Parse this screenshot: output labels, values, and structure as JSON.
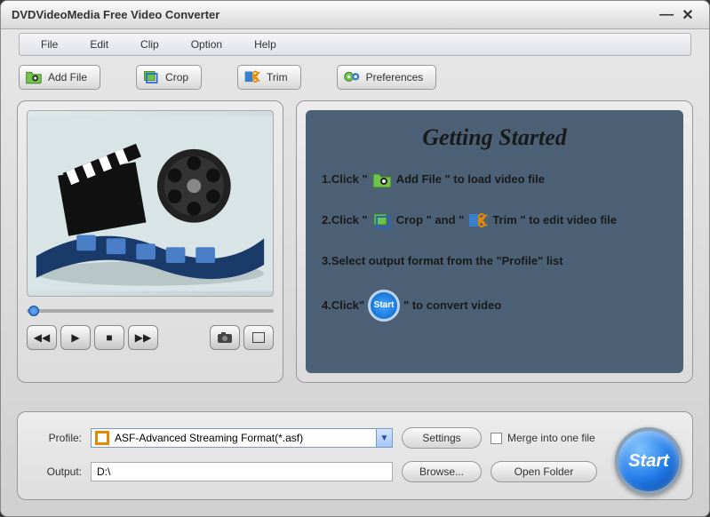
{
  "window": {
    "title": "DVDVideoMedia Free Video Converter"
  },
  "menu": {
    "file": "File",
    "edit": "Edit",
    "clip": "Clip",
    "option": "Option",
    "help": "Help"
  },
  "toolbar": {
    "add_file": "Add File",
    "crop": "Crop",
    "trim": "Trim",
    "preferences": "Preferences"
  },
  "guide": {
    "title": "Getting Started",
    "step1a": "1.Click \"",
    "step1b": "Add File \" to load video file",
    "step2a": "2.Click \"",
    "step2b": " Crop \" and \"",
    "step2c": "Trim \" to edit video file",
    "step3": "3.Select output format from the \"Profile\" list",
    "step4a": "4.Click\"",
    "step4b": "\" to convert video",
    "start_badge": "Start"
  },
  "bottom": {
    "profile_label": "Profile:",
    "profile_value": "ASF-Advanced Streaming Format(*.asf)",
    "settings": "Settings",
    "merge": "Merge into one file",
    "output_label": "Output:",
    "output_value": "D:\\",
    "browse": "Browse...",
    "open_folder": "Open Folder"
  },
  "start": "Start"
}
